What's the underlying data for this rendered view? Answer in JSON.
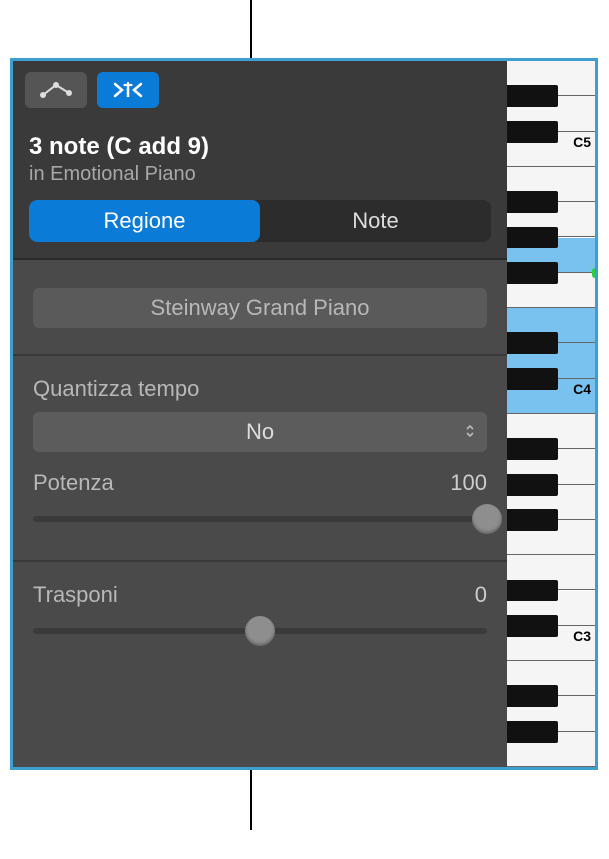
{
  "header": {
    "title": "3 note (C add 9)",
    "subtitle": "in Emotional Piano"
  },
  "tabs": {
    "region": "Regione",
    "note": "Note"
  },
  "region_name": "Steinway Grand Piano",
  "quantize": {
    "label": "Quantizza tempo",
    "value": "No"
  },
  "strength": {
    "label": "Potenza",
    "value": "100",
    "percent": 100
  },
  "transpose": {
    "label": "Trasponi",
    "value": "0",
    "percent": 50
  },
  "piano": {
    "labels": {
      "c5": "C5",
      "c4": "C4",
      "c3": "C3"
    },
    "highlighted": [
      "C4",
      "D4",
      "E4",
      "G4"
    ]
  },
  "icons": {
    "automation": "automation-icon",
    "catch": "catch-icon"
  }
}
